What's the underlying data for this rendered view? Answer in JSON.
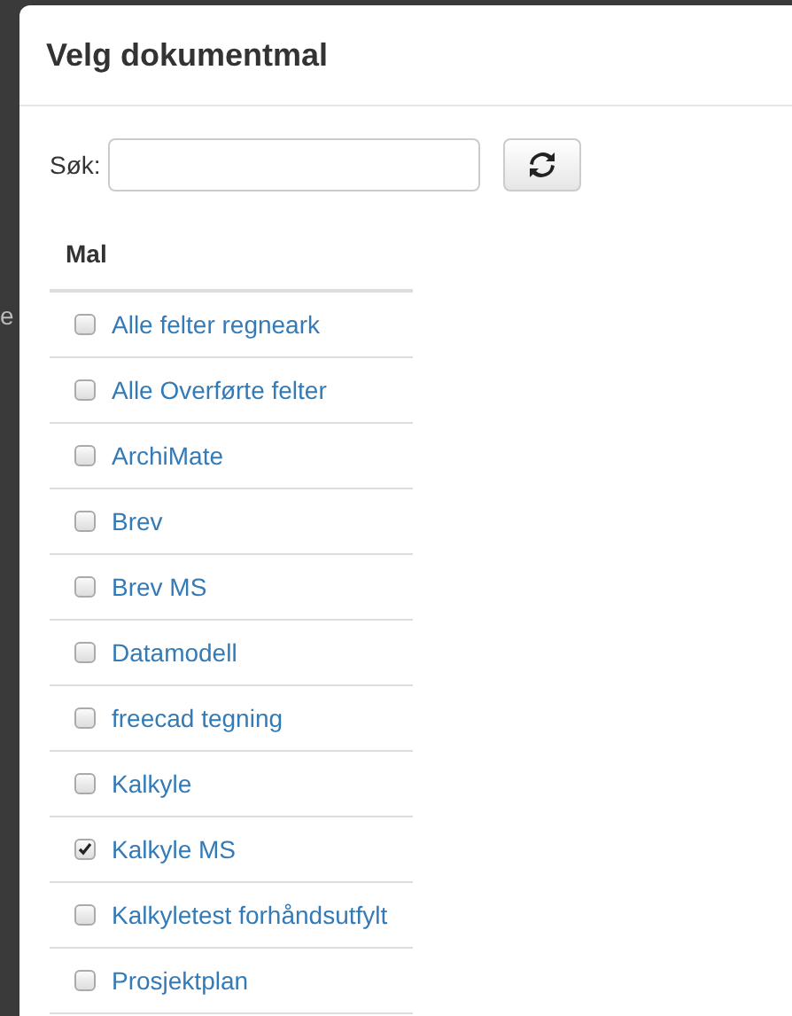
{
  "background_text": "e",
  "dialog": {
    "title": "Velg dokumentmal"
  },
  "search": {
    "label": "Søk:"
  },
  "table": {
    "columns": [
      "Mal"
    ],
    "rows": [
      {
        "name": "Alle felter regneark",
        "checked": false
      },
      {
        "name": "Alle Overførte felter",
        "checked": false
      },
      {
        "name": "ArchiMate",
        "checked": false
      },
      {
        "name": "Brev",
        "checked": false
      },
      {
        "name": "Brev MS",
        "checked": false
      },
      {
        "name": "Datamodell",
        "checked": false
      },
      {
        "name": "freecad tegning",
        "checked": false
      },
      {
        "name": "Kalkyle",
        "checked": false
      },
      {
        "name": "Kalkyle MS",
        "checked": true
      },
      {
        "name": "Kalkyletest forhåndsutfylt",
        "checked": false
      },
      {
        "name": "Prosjektplan",
        "checked": false
      }
    ]
  }
}
